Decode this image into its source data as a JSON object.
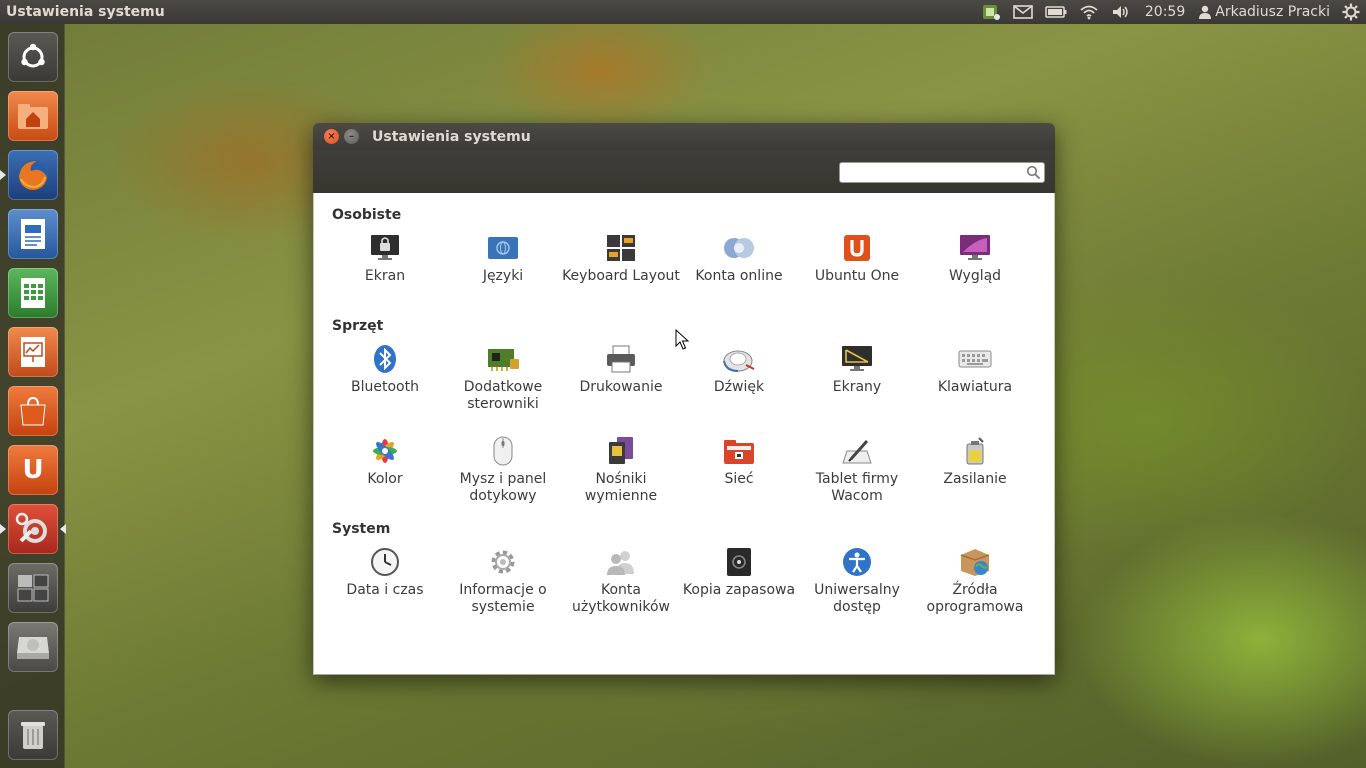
{
  "panel": {
    "app_title": "Ustawienia systemu",
    "clock": "20:59",
    "user": "Arkadiusz Pracki"
  },
  "window": {
    "title": "Ustawienia systemu",
    "search_placeholder": "",
    "close_glyph": "×",
    "minimize_glyph": "–"
  },
  "sections": [
    {
      "label": "Osobiste",
      "items": [
        "Ekran",
        "Języki",
        "Keyboard Layout",
        "Konta online",
        "Ubuntu One",
        "Wygląd"
      ]
    },
    {
      "label": "Sprzęt",
      "items": [
        "Bluetooth",
        "Dodatkowe sterowniki",
        "Drukowanie",
        "Dźwięk",
        "Ekrany",
        "Klawiatura",
        "Kolor",
        "Mysz i panel dotykowy",
        "Nośniki wymienne",
        "Sieć",
        "Tablet firmy Wacom",
        "Zasilanie"
      ]
    },
    {
      "label": "System",
      "items": [
        "Data i czas",
        "Informacje o systemie",
        "Konta użytkowników",
        "Kopia zapasowa",
        "Uniwersalny dostęp",
        "Źródła oprogramowa"
      ]
    }
  ],
  "colors": {
    "panel_bg": "#3c3b37",
    "ubuntu_orange": "#dd4814",
    "window_bg": "#ffffff"
  }
}
